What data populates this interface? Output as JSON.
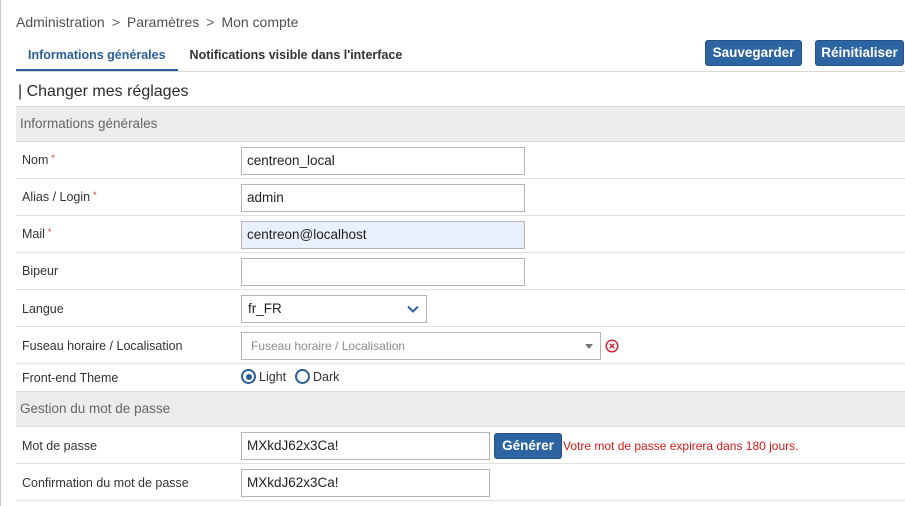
{
  "breadcrumb": [
    "Administration",
    "Paramètres",
    "Mon compte"
  ],
  "breadcrumb_separator": ">",
  "tabs": [
    {
      "label": "Informations générales",
      "active": true
    },
    {
      "label": "Notifications visible dans l'interface",
      "active": false
    }
  ],
  "actions": {
    "save_label": "Sauvegarder",
    "reset_label": "Réinitialiser"
  },
  "page_title": "| Changer mes réglages",
  "sections": {
    "general": "Informations générales",
    "password": "Gestion du mot de passe"
  },
  "fields": {
    "name": {
      "label": "Nom",
      "value": "centreon_local",
      "required": true
    },
    "alias": {
      "label": "Alias / Login",
      "value": "admin",
      "required": true
    },
    "mail": {
      "label": "Mail",
      "value": "centreon@localhost",
      "required": true
    },
    "pager": {
      "label": "Bipeur",
      "value": ""
    },
    "language": {
      "label": "Langue",
      "value": "fr_FR"
    },
    "timezone": {
      "label": "Fuseau horaire / Localisation",
      "placeholder": "Fuseau horaire / Localisation"
    },
    "theme": {
      "label": "Front-end Theme",
      "options": [
        "Light",
        "Dark"
      ],
      "selected": "Light"
    },
    "password": {
      "label": "Mot de passe",
      "value": "MXkdJ62x3Ca!"
    },
    "password_confirm": {
      "label": "Confirmation du mot de passe",
      "value": "MXkdJ62x3Ca!"
    }
  },
  "required_marker": "*",
  "generate_label": "Générer",
  "expiration_notice": "Votre mot de passe expirera dans 180 jours.",
  "colors": {
    "accent": "#2d65a3",
    "error": "#d81818",
    "section_bg": "#ececec"
  }
}
